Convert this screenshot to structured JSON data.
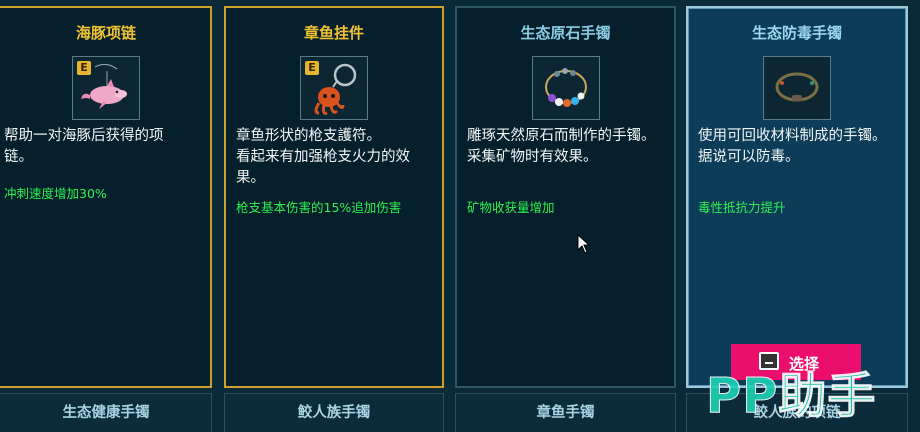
{
  "cards": [
    {
      "title": "海豚项链",
      "badge": "E",
      "icon": "dolphin-necklace-icon",
      "description": "帮助一对海豚后获得的项链。",
      "effect": "冲刺速度增加30%"
    },
    {
      "title": "章鱼挂件",
      "badge": "E",
      "icon": "octopus-keychain-icon",
      "description": "章鱼形状的枪支護符。\n看起来有加强枪支火力的效果。",
      "effect": "枪支基本伤害的15%追加伤害"
    },
    {
      "title": "生态原石手镯",
      "icon": "gemstone-bracelet-icon",
      "description": "雕琢天然原石而制作的手镯。\n采集矿物时有效果。",
      "effect": "矿物收获量增加"
    },
    {
      "title": "生态防毒手镯",
      "icon": "recycled-bracelet-icon",
      "description": "使用可回收材料制成的手镯。\n据说可以防毒。",
      "effect": "毒性抵抗力提升",
      "button_label": "选择"
    }
  ],
  "bottom_tabs": [
    "生态健康手镯",
    "鲛人族手镯",
    "章鱼手镯",
    "鲛人族的项链"
  ],
  "watermark": "PP助手",
  "colors": {
    "rare_border": "#cfa12a",
    "effect_text": "#2ff050",
    "select_button": "#ea0f6c",
    "watermark": "#1cd0b2"
  }
}
